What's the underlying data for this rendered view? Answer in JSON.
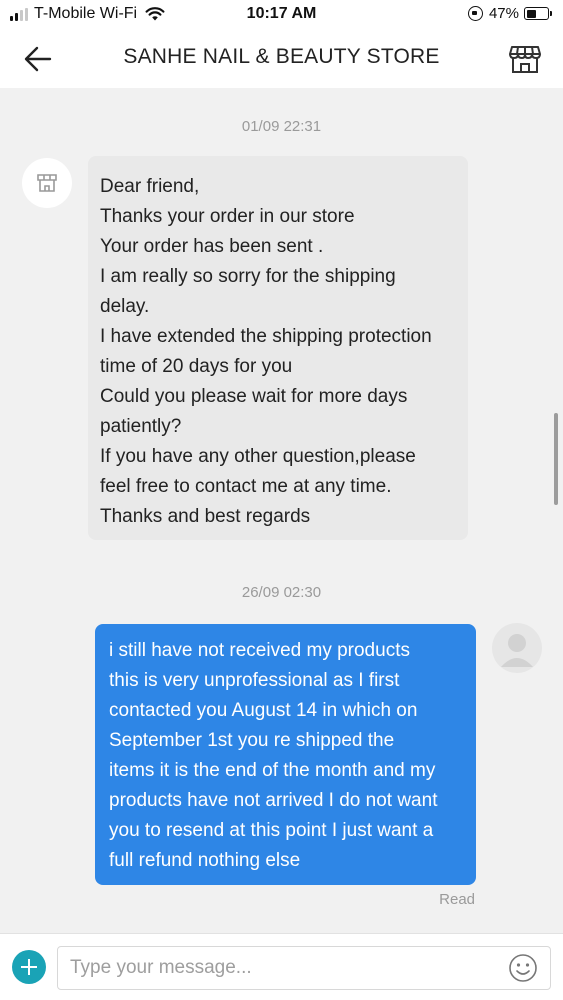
{
  "status_bar": {
    "carrier": "T-Mobile Wi-Fi",
    "time": "10:17 AM",
    "battery": "47%",
    "battery_level": 0.47
  },
  "header": {
    "title": "SANHE NAIL & BEAUTY STORE",
    "back_icon": "arrow-left-icon",
    "store_icon": "storefront-icon"
  },
  "messages": [
    {
      "timestamp": "01/09 22:31",
      "sender": "store",
      "lines": [
        "Dear friend,",
        "Thanks your order in our store",
        "Your order has been sent .",
        "I am really so sorry for the shipping",
        "delay.",
        "I have extended the shipping protection",
        "time of 20 days for you",
        "Could you please wait for more days",
        "patiently?",
        "If you have any other question,please",
        "feel free to contact me at any time.",
        "Thanks and best regards"
      ]
    },
    {
      "timestamp": "26/09 02:30",
      "sender": "user",
      "lines": [
        "i still have not received my products",
        "this is very unprofessional as I first",
        "contacted you August 14 in which on",
        "September 1st you re shipped the",
        "items it is the end of the month and my",
        "products have not arrived I do not want",
        "you to resend at this point I just want a",
        "full refund nothing else"
      ],
      "status": "Read"
    }
  ],
  "composer": {
    "placeholder": "Type your message...",
    "value": ""
  },
  "colors": {
    "outgoing_bubble": "#2e86e6",
    "incoming_bubble": "#e9e9e9",
    "accent": "#1aa3b6"
  }
}
